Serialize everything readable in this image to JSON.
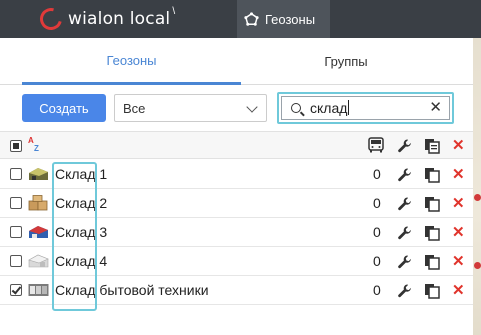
{
  "app": {
    "logo_text": "wialon local",
    "active_module": "Геозоны"
  },
  "tabs": [
    {
      "label": "Геозоны",
      "active": true
    },
    {
      "label": "Группы",
      "active": false
    }
  ],
  "toolbar": {
    "create_label": "Создать",
    "filter_value": "Все",
    "search_value": "склад"
  },
  "colors": {
    "accent": "#4a86e8",
    "highlight": "#6fc9da",
    "delete": "#e0342c",
    "topbar": "#3a3f45"
  },
  "rows": [
    {
      "name": "Склад 1",
      "count": "0",
      "checked": false,
      "icon": "warehouse-dark-icon"
    },
    {
      "name": "Склад 2",
      "count": "0",
      "checked": false,
      "icon": "boxes-icon"
    },
    {
      "name": "Склад 3",
      "count": "0",
      "checked": false,
      "icon": "warehouse-blue-red-icon"
    },
    {
      "name": "Склад 4",
      "count": "0",
      "checked": false,
      "icon": "warehouse-white-icon"
    },
    {
      "name": "Склад бытовой техники",
      "count": "0",
      "checked": true,
      "icon": "appliances-store-icon"
    }
  ]
}
